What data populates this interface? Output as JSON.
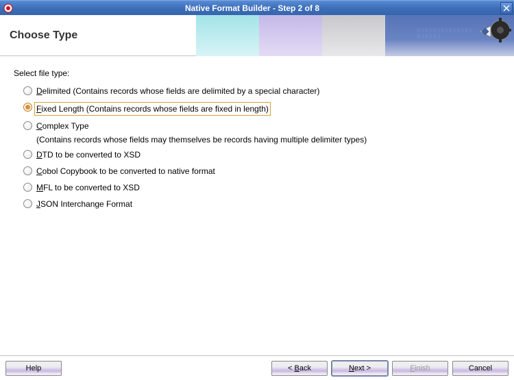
{
  "window": {
    "title": "Native Format Builder - Step 2 of 8"
  },
  "header": {
    "title": "Choose Type"
  },
  "content": {
    "prompt": "Select file type:",
    "options": [
      {
        "id": "delimited",
        "underline_char": "D",
        "rest": "elimited (Contains records whose fields are delimited by a special character)",
        "selected": false,
        "sub": null
      },
      {
        "id": "fixed",
        "underline_char": "F",
        "rest": "ixed Length (Contains records whose fields are fixed in length)",
        "selected": true,
        "sub": null
      },
      {
        "id": "complex",
        "underline_char": "C",
        "rest": "omplex Type",
        "selected": false,
        "sub": "(Contains records whose fields may themselves be records having multiple delimiter types)"
      },
      {
        "id": "dtd",
        "underline_char": "D",
        "rest": "TD to be converted to XSD",
        "disabled_underline": true,
        "selected": false,
        "sub": null
      },
      {
        "id": "cobol",
        "underline_char": "C",
        "rest": "obol Copybook to be converted to native format",
        "disabled_underline": true,
        "selected": false,
        "sub": null
      },
      {
        "id": "mfl",
        "underline_char": "M",
        "rest": "FL to be converted to XSD",
        "selected": false,
        "sub": null
      },
      {
        "id": "json",
        "underline_char": "J",
        "rest": "SON Interchange Format",
        "selected": false,
        "sub": null
      }
    ]
  },
  "footer": {
    "help": "Help",
    "back": "< Back",
    "next": "Next >",
    "finish": "Finish",
    "cancel": "Cancel"
  }
}
